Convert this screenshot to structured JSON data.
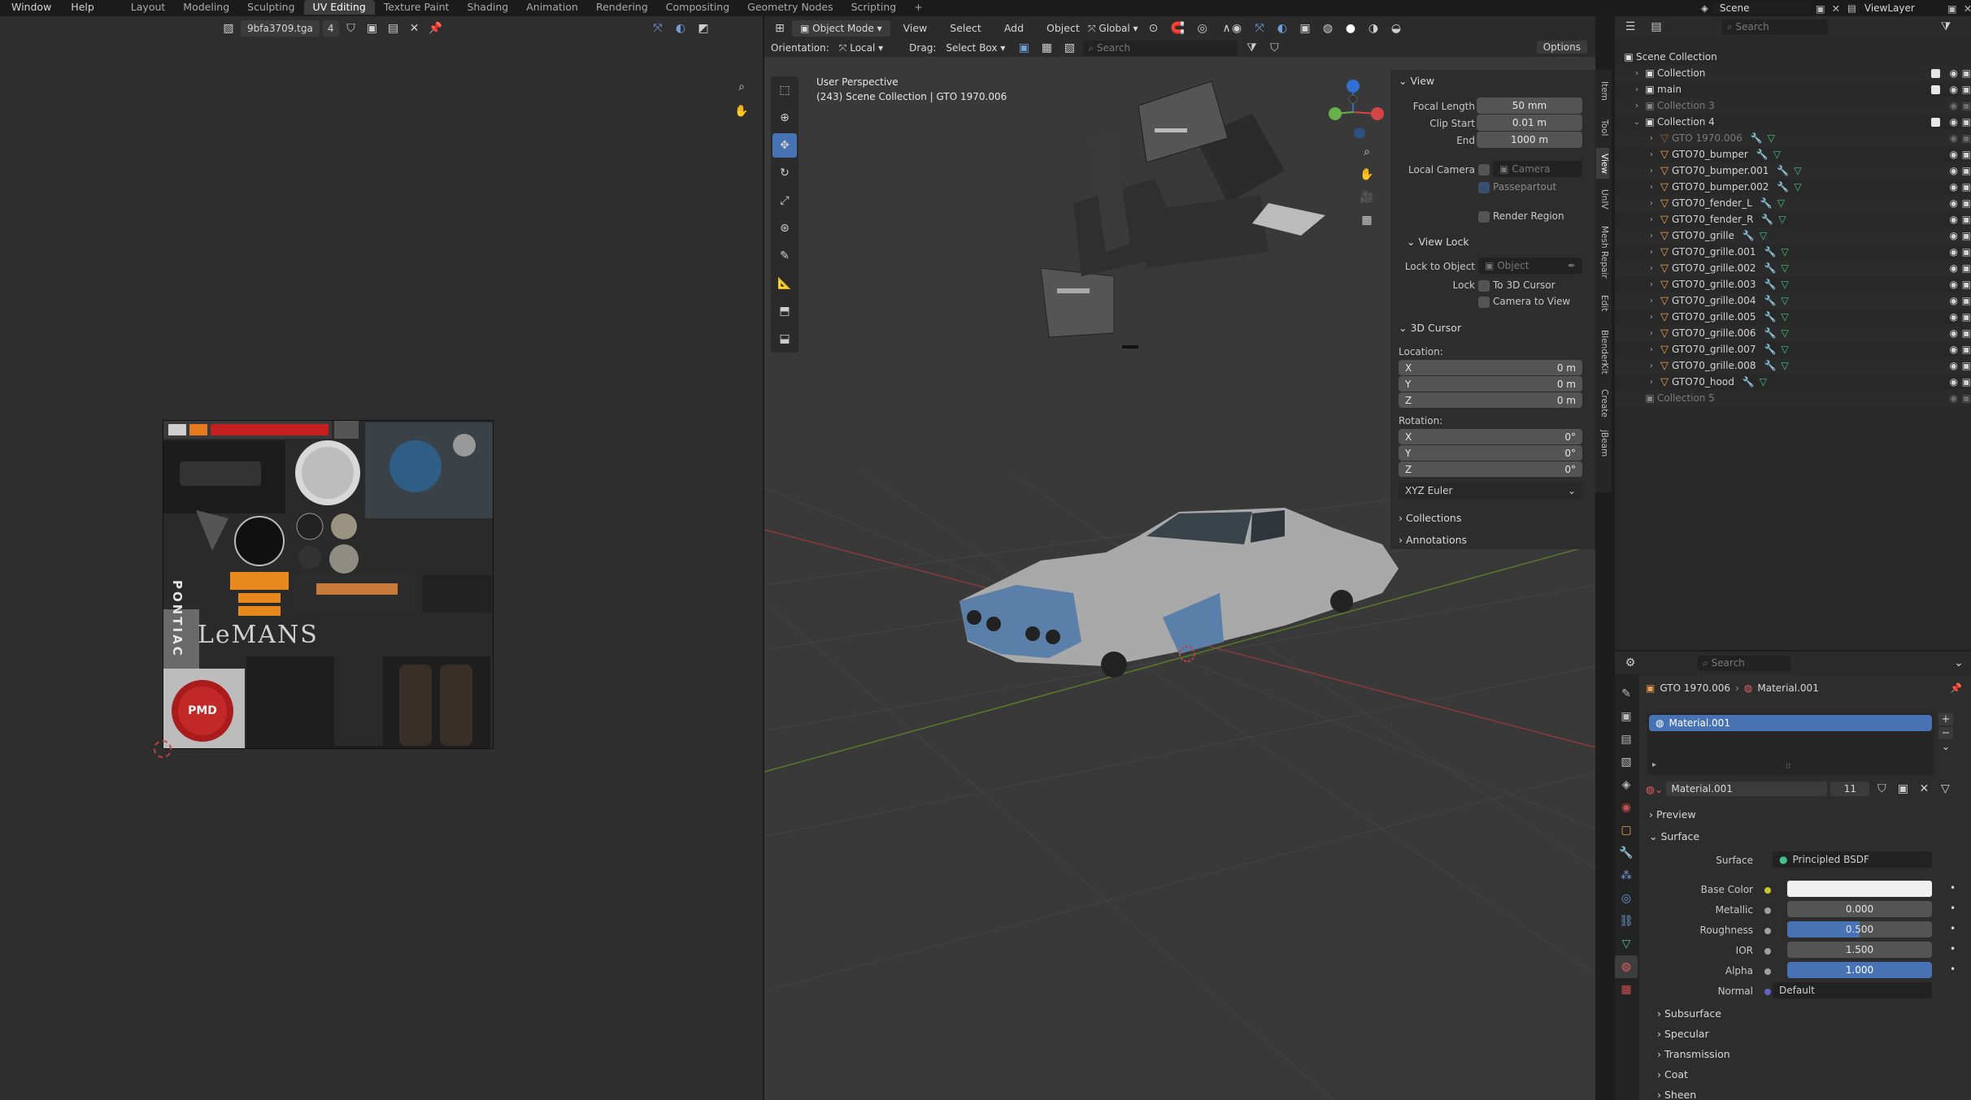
{
  "topbar": {
    "menus": [
      "Window",
      "Help"
    ],
    "workspaces": [
      "Layout",
      "Modeling",
      "Sculpting",
      "UV Editing",
      "Texture Paint",
      "Shading",
      "Animation",
      "Rendering",
      "Compositing",
      "Geometry Nodes",
      "Scripting"
    ],
    "active_workspace": "UV Editing",
    "add_tab": "+",
    "scene": "Scene",
    "view_layer": "ViewLayer"
  },
  "uv_editor": {
    "image_name": "9bfa3709.tga",
    "users": "4",
    "texture_lettering": {
      "brand": "LeMANS",
      "badge": "PMD",
      "side_text": "PONTIAC"
    }
  },
  "viewport": {
    "mode": "Object Mode",
    "menus": [
      "View",
      "Select",
      "Add",
      "Object"
    ],
    "transform_orientation": "Global",
    "orientation_label": "Orientation:",
    "orientation_value": "Local",
    "drag_label": "Drag:",
    "drag_value": "Select Box",
    "search_placeholder": "Search",
    "options": "Options",
    "overlay_title": "User Perspective",
    "overlay_subtitle": "(243) Scene Collection | GTO 1970.006"
  },
  "n_panel": {
    "tabs": [
      "Item",
      "Tool",
      "View",
      "UnIV",
      "Mesh Repair",
      "Edit",
      "BlenderKit",
      "Create",
      "jBeam"
    ],
    "view_section": "View",
    "focal_length_label": "Focal Length",
    "focal_length": "50 mm",
    "clip_start_label": "Clip Start",
    "clip_start": "0.01 m",
    "end_label": "End",
    "end": "1000 m",
    "local_camera_label": "Local Camera",
    "camera_placeholder": "Camera",
    "passepartout": "Passepartout",
    "render_region": "Render Region",
    "view_lock_section": "View Lock",
    "lock_to_object_label": "Lock to Object",
    "object_placeholder": "Object",
    "lock_label": "Lock",
    "to_3d_cursor": "To 3D Cursor",
    "camera_to_view": "Camera to View",
    "cursor_section": "3D Cursor",
    "location_label": "Location:",
    "location": [
      {
        "axis": "X",
        "value": "0 m"
      },
      {
        "axis": "Y",
        "value": "0 m"
      },
      {
        "axis": "Z",
        "value": "0 m"
      }
    ],
    "rotation_label": "Rotation:",
    "rotation": [
      {
        "axis": "X",
        "value": "0°"
      },
      {
        "axis": "Y",
        "value": "0°"
      },
      {
        "axis": "Z",
        "value": "0°"
      }
    ],
    "rotation_mode": "XYZ Euler",
    "collections_section": "Collections",
    "annotations_section": "Annotations"
  },
  "outliner": {
    "search_placeholder": "Search",
    "root": "Scene Collection",
    "rows": [
      {
        "name": "Collection",
        "kind": "collection"
      },
      {
        "name": "main",
        "kind": "collection"
      },
      {
        "name": "Collection 3",
        "kind": "collection",
        "dim": true
      },
      {
        "name": "Collection 4",
        "kind": "collection"
      },
      {
        "name": "GTO 1970.006",
        "kind": "object",
        "dim": true
      },
      {
        "name": "GTO70_bumper",
        "kind": "object"
      },
      {
        "name": "GTO70_bumper.001",
        "kind": "object"
      },
      {
        "name": "GTO70_bumper.002",
        "kind": "object"
      },
      {
        "name": "GTO70_fender_L",
        "kind": "object"
      },
      {
        "name": "GTO70_fender_R",
        "kind": "object"
      },
      {
        "name": "GTO70_grille",
        "kind": "object"
      },
      {
        "name": "GTO70_grille.001",
        "kind": "object"
      },
      {
        "name": "GTO70_grille.002",
        "kind": "object"
      },
      {
        "name": "GTO70_grille.003",
        "kind": "object"
      },
      {
        "name": "GTO70_grille.004",
        "kind": "object"
      },
      {
        "name": "GTO70_grille.005",
        "kind": "object"
      },
      {
        "name": "GTO70_grille.006",
        "kind": "object"
      },
      {
        "name": "GTO70_grille.007",
        "kind": "object"
      },
      {
        "name": "GTO70_grille.008",
        "kind": "object"
      },
      {
        "name": "GTO70_hood",
        "kind": "object"
      },
      {
        "name": "Collection 5",
        "kind": "collection",
        "dim": true
      }
    ]
  },
  "properties": {
    "search_placeholder": "Search",
    "breadcrumb_object": "GTO 1970.006",
    "breadcrumb_material": "Material.001",
    "slot": "Material.001",
    "material_name": "Material.001",
    "users": "11",
    "preview_section": "Preview",
    "surface_section": "Surface",
    "surface_label": "Surface",
    "surface_value": "Principled BSDF",
    "base_color_label": "Base Color",
    "metallic_label": "Metallic",
    "metallic": "0.000",
    "roughness_label": "Roughness",
    "roughness": "0.500",
    "ior_label": "IOR",
    "ior": "1.500",
    "alpha_label": "Alpha",
    "alpha": "1.000",
    "normal_label": "Normal",
    "normal_value": "Default",
    "subsections": [
      "Subsurface",
      "Specular",
      "Transmission",
      "Coat",
      "Sheen"
    ]
  },
  "colors": {
    "accent_blue": "#4772b3",
    "object_orange": "#f0a04b",
    "mesh_green": "#42c48a",
    "car_blue": "#5a7fa8"
  }
}
